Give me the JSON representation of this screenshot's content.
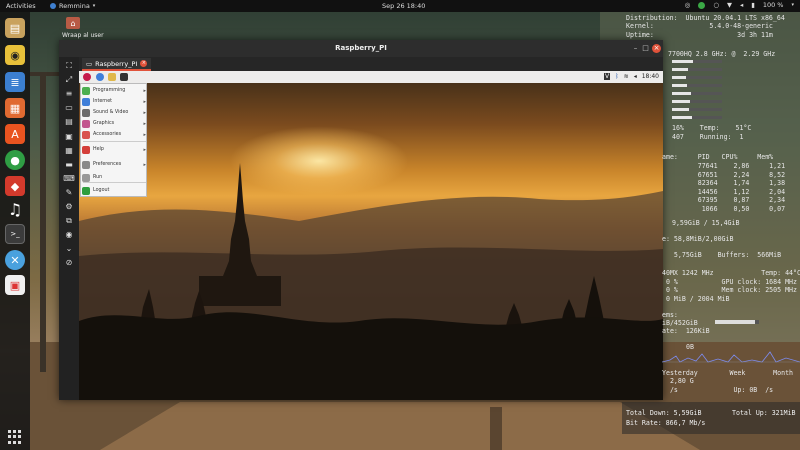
{
  "topbar": {
    "activities": "Activities",
    "app_name": "Remmina",
    "clock": "Sep 26  18:40",
    "battery": "100 %"
  },
  "desktop": {
    "home_label": "Wraap al user"
  },
  "window": {
    "title": "Raspberry_PI",
    "tab_label": "Raspberry_PI"
  },
  "remote": {
    "tray_time": "18:40",
    "menu": [
      {
        "label": "Programming",
        "color": "#4caf50",
        "submenu": true
      },
      {
        "label": "Internet",
        "color": "#3f7fd9",
        "submenu": true
      },
      {
        "label": "Sound & Video",
        "color": "#6b6b6b",
        "submenu": true
      },
      {
        "label": "Graphics",
        "color": "#c2568e",
        "submenu": true
      },
      {
        "label": "Accessories",
        "color": "#d9534f",
        "submenu": true
      },
      {
        "label": "Help",
        "color": "#d43f3a",
        "submenu": true
      },
      {
        "label": "Preferences",
        "color": "#8a8a8a",
        "submenu": true
      },
      {
        "label": "Run",
        "color": "#999999",
        "submenu": false
      },
      {
        "label": "Logout",
        "color": "#2e9e3e",
        "submenu": false
      }
    ]
  },
  "conky": {
    "distribution": "Distribution:  Ubuntu 20.04.1 LTS x86_64",
    "kernel": "Kernel:              5.4.0-48-generic",
    "uptime": "Uptime:                     3d 3h 11m",
    "cpu_model": "7700HQ 2.8 GHz: @  2.29 GHz",
    "core_bars": [
      0.42,
      0.32,
      0.28,
      0.3,
      0.38,
      0.35,
      0.33,
      0.4
    ],
    "cpu_line": " 16%    Temp:    51°C",
    "proc_line": " 407    Running:  1",
    "proc_header": "ame:     PID   CPU%     Mem%",
    "procs": [
      "         77641    2,86     1,21",
      "         67651    2,24     8,52",
      "         82364    1,74     1,38",
      "         14456    1,12     2,04",
      "         67395    0,87     2,34",
      "          1066    0,50     0,07"
    ],
    "mem": " 9,59GiB / 15,4GiB",
    "swap": "e: 58,8MiB/2,00GiB",
    "cached": "   5,75GiB    Buffers:  566MiB",
    "gpu_model": "40MX 1242 MHz            Temp: 44°C",
    "gpu_line1": " 0 %           GPU clock: 1684 MHz",
    "gpu_line2": " 0 %           Mem clock: 2505 MHz",
    "gpu_mem": " 0 MiB / 2004 MiB",
    "disk_label": "ems:",
    "disk": "iB/452GiB",
    "disk_rate": "ate:  126KiB",
    "disk_bar": 0.9,
    "net_down_label": "0B",
    "yesterday": "Yesterday        Week       Month",
    "yest_val": "  2,80 G",
    "up_line": "  /s              Up: 0B  /s",
    "total_down": "Total Down: 5,59GiB",
    "total_up": "Total Up: 321MiB",
    "bitrate": "Bit Rate: 866,7 Mb/s"
  }
}
